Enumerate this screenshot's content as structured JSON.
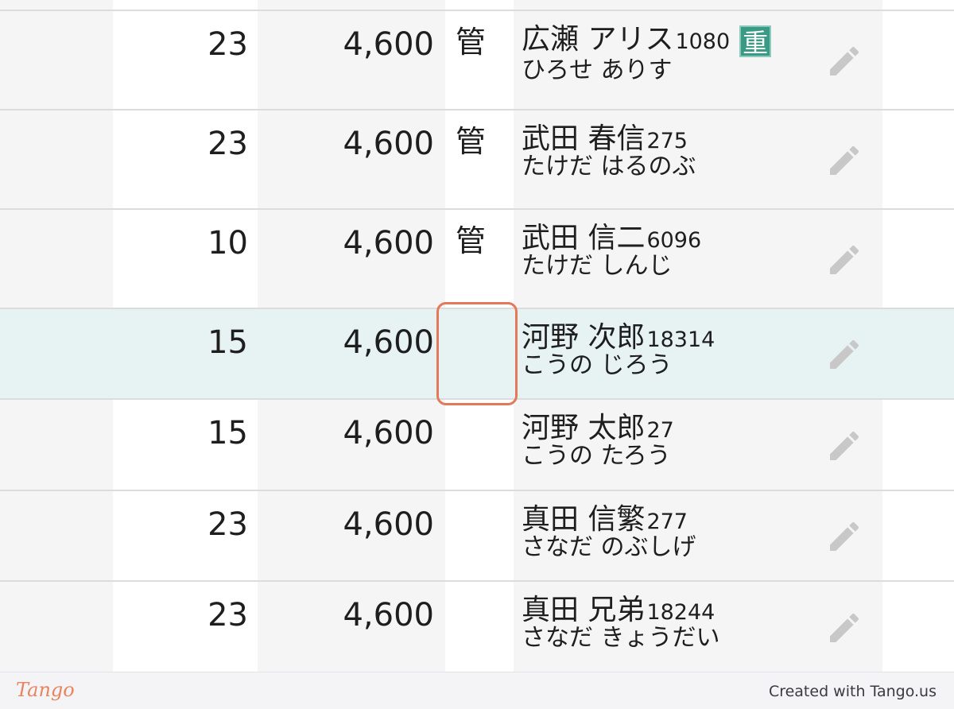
{
  "rows": [
    {
      "qty": "23",
      "price": "4,600",
      "mark": "管",
      "name": "広瀬 アリス",
      "id": "1080",
      "kana": "ひろせ ありす",
      "badge": "重",
      "selected": false
    },
    {
      "qty": "23",
      "price": "4,600",
      "mark": "管",
      "name": "武田 春信",
      "id": "275",
      "kana": "たけだ はるのぶ",
      "badge": "",
      "selected": false
    },
    {
      "qty": "10",
      "price": "4,600",
      "mark": "管",
      "name": "武田 信二",
      "id": "6096",
      "kana": "たけだ しんじ",
      "badge": "",
      "selected": false
    },
    {
      "qty": "15",
      "price": "4,600",
      "mark": "",
      "name": "河野 次郎",
      "id": "18314",
      "kana": "こうの じろう",
      "badge": "",
      "selected": true
    },
    {
      "qty": "15",
      "price": "4,600",
      "mark": "",
      "name": "河野 太郎",
      "id": "27",
      "kana": "こうの たろう",
      "badge": "",
      "selected": false
    },
    {
      "qty": "23",
      "price": "4,600",
      "mark": "",
      "name": "真田 信繁",
      "id": "277",
      "kana": "さなだ のぶしげ",
      "badge": "",
      "selected": false
    },
    {
      "qty": "23",
      "price": "4,600",
      "mark": "",
      "name": "真田 兄弟",
      "id": "18244",
      "kana": "さなだ きょうだい",
      "badge": "",
      "selected": false
    }
  ],
  "icons": {
    "edit": "pencil-icon"
  },
  "colors": {
    "highlight": "#e3795a",
    "selected_row": "#e7f3f3",
    "badge": "#3b9a86",
    "pencil": "#c8c8c8"
  },
  "footer": {
    "logo": "Tango",
    "credit": "Created with Tango.us"
  }
}
